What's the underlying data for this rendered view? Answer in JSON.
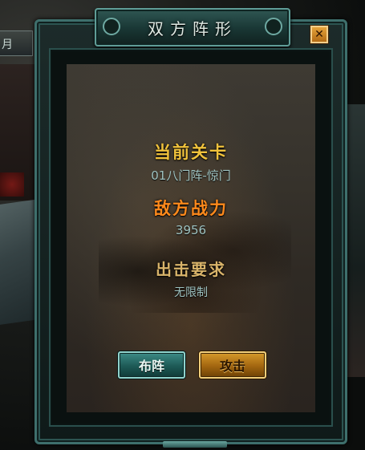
{
  "background": {
    "left_tab_text": "月"
  },
  "dialog": {
    "title": "双方阵形",
    "close_icon": "close-icon",
    "stage_label": "当前关卡",
    "stage_value": "01八门阵-惊门",
    "enemy_power_label": "敌方战力",
    "enemy_power_value": "3956",
    "requirement_label": "出击要求",
    "requirement_value": "无限制",
    "formation_button": "布阵",
    "attack_button": "攻击"
  },
  "colors": {
    "stage_label": "#f0c23c",
    "enemy_power_label": "#ff8a1c",
    "requirement_label": "#d9b46a",
    "value_text": "#9fc3c1"
  }
}
